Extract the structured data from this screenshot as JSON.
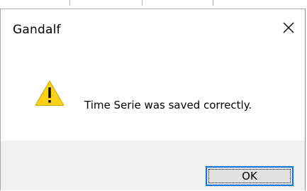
{
  "dialog": {
    "title": "Gandalf",
    "close_icon": "close-icon",
    "message": "Time Serie was saved correctly.",
    "icon": "warning-icon",
    "ok_label": "OK"
  },
  "colors": {
    "warning_fill": "#fcd116",
    "footer_bg": "#f0f0f0",
    "button_focus_border": "#0078d7",
    "button_bg": "#e1e1e1"
  }
}
